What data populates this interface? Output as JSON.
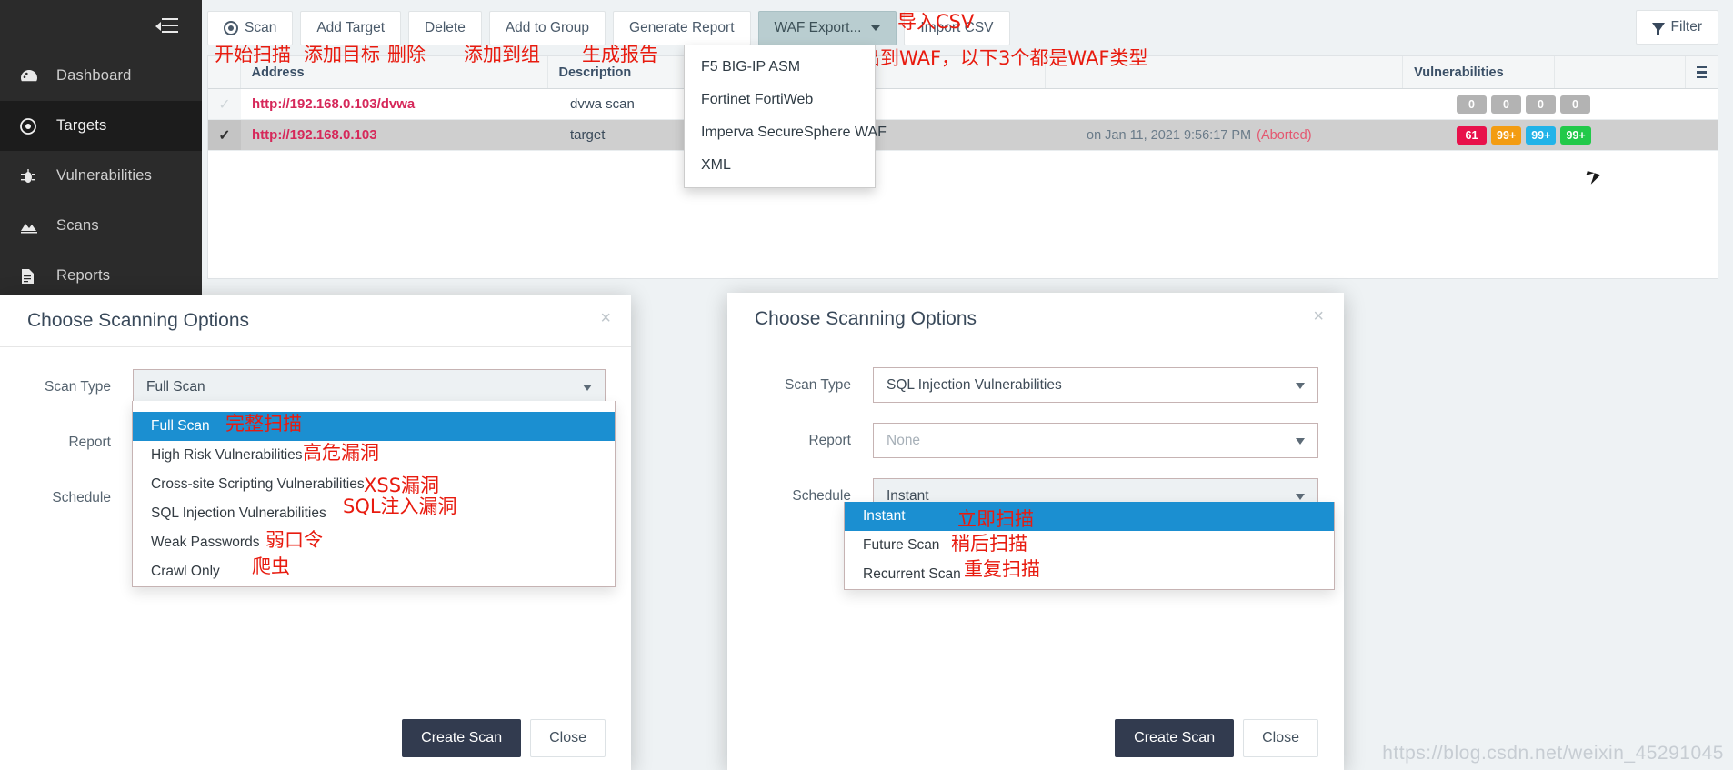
{
  "sidebar": {
    "toggle_icon": "collapse-menu-icon",
    "items": [
      {
        "label": "Dashboard",
        "icon": "dashboard-icon",
        "active": false
      },
      {
        "label": "Targets",
        "icon": "target-icon",
        "active": true
      },
      {
        "label": "Vulnerabilities",
        "icon": "bug-icon",
        "active": false
      },
      {
        "label": "Scans",
        "icon": "chart-icon",
        "active": false
      },
      {
        "label": "Reports",
        "icon": "document-icon",
        "active": false
      }
    ]
  },
  "toolbar": {
    "scan_label": "Scan",
    "add_target_label": "Add Target",
    "delete_label": "Delete",
    "add_to_group_label": "Add to Group",
    "generate_report_label": "Generate Report",
    "waf_export_label": "WAF Export...",
    "import_csv_label": "Import CSV",
    "filter_label": "Filter"
  },
  "waf_menu": {
    "items": [
      "F5 BIG-IP ASM",
      "Fortinet FortiWeb",
      "Imperva SecureSphere WAF",
      "XML"
    ]
  },
  "table": {
    "headers": {
      "address": "Address",
      "description": "Description",
      "status": "",
      "vulnerabilities": "Vulnerabilities",
      "menu": ""
    },
    "rows": [
      {
        "checked": false,
        "address": "http://192.168.0.103/dvwa",
        "description": "dvwa scan",
        "status": "",
        "status_suffix": "",
        "badges": [
          {
            "value": "0",
            "color": "gray"
          },
          {
            "value": "0",
            "color": "gray"
          },
          {
            "value": "0",
            "color": "gray"
          },
          {
            "value": "0",
            "color": "gray"
          }
        ]
      },
      {
        "checked": true,
        "address": "http://192.168.0.103",
        "description": "target",
        "status": "on Jan 11, 2021 9:56:17 PM",
        "status_suffix": "(Aborted)",
        "badges": [
          {
            "value": "61",
            "color": "red"
          },
          {
            "value": "99+",
            "color": "orange"
          },
          {
            "value": "99+",
            "color": "blue"
          },
          {
            "value": "99+",
            "color": "green"
          }
        ]
      }
    ]
  },
  "modal_left": {
    "title": "Choose Scanning Options",
    "close_label": "×",
    "labels": {
      "scan_type": "Scan Type",
      "report": "Report",
      "schedule": "Schedule"
    },
    "scan_type_value": "Full Scan",
    "scan_type_options": [
      "Full Scan",
      "High Risk Vulnerabilities",
      "Cross-site Scripting Vulnerabilities",
      "SQL Injection Vulnerabilities",
      "Weak Passwords",
      "Crawl Only"
    ],
    "selected_option_index": 0,
    "create_scan_label": "Create Scan",
    "close_button_label": "Close"
  },
  "modal_right": {
    "title": "Choose Scanning Options",
    "close_label": "×",
    "labels": {
      "scan_type": "Scan Type",
      "report": "Report",
      "schedule": "Schedule"
    },
    "scan_type_value": "SQL Injection Vulnerabilities",
    "report_placeholder": "None",
    "schedule_value": "Instant",
    "schedule_options": [
      "Instant",
      "Future Scan",
      "Recurrent Scan"
    ],
    "selected_option_index": 0,
    "create_scan_label": "Create Scan",
    "close_button_label": "Close"
  },
  "annotations": {
    "scan": "开始扫描",
    "add_target": "添加目标",
    "delete": "删除",
    "add_to_group": "添加到组",
    "generate_report": "生成报告",
    "import_csv": "导入CSV",
    "waf_export": "将结果导出到WAF，以下3个都是WAF类型",
    "full_scan": "完整扫描",
    "high_risk": "高危漏洞",
    "xss": "XSS漏洞",
    "sqli": "SQL注入漏洞",
    "weak_password": "弱口令",
    "crawl_only": "爬虫",
    "instant": "立即扫描",
    "future_scan": "稍后扫描",
    "recurrent_scan": "重复扫描"
  },
  "watermark": {
    "text": "https://blog.csdn.net/weixin_45291045"
  },
  "colors": {
    "sidebar_bg": "#2b2b2b",
    "accent_blue": "#1b8fd1",
    "link_red": "#d6285a",
    "annotation_red": "#e81b0f",
    "primary_button": "#323b4f"
  }
}
